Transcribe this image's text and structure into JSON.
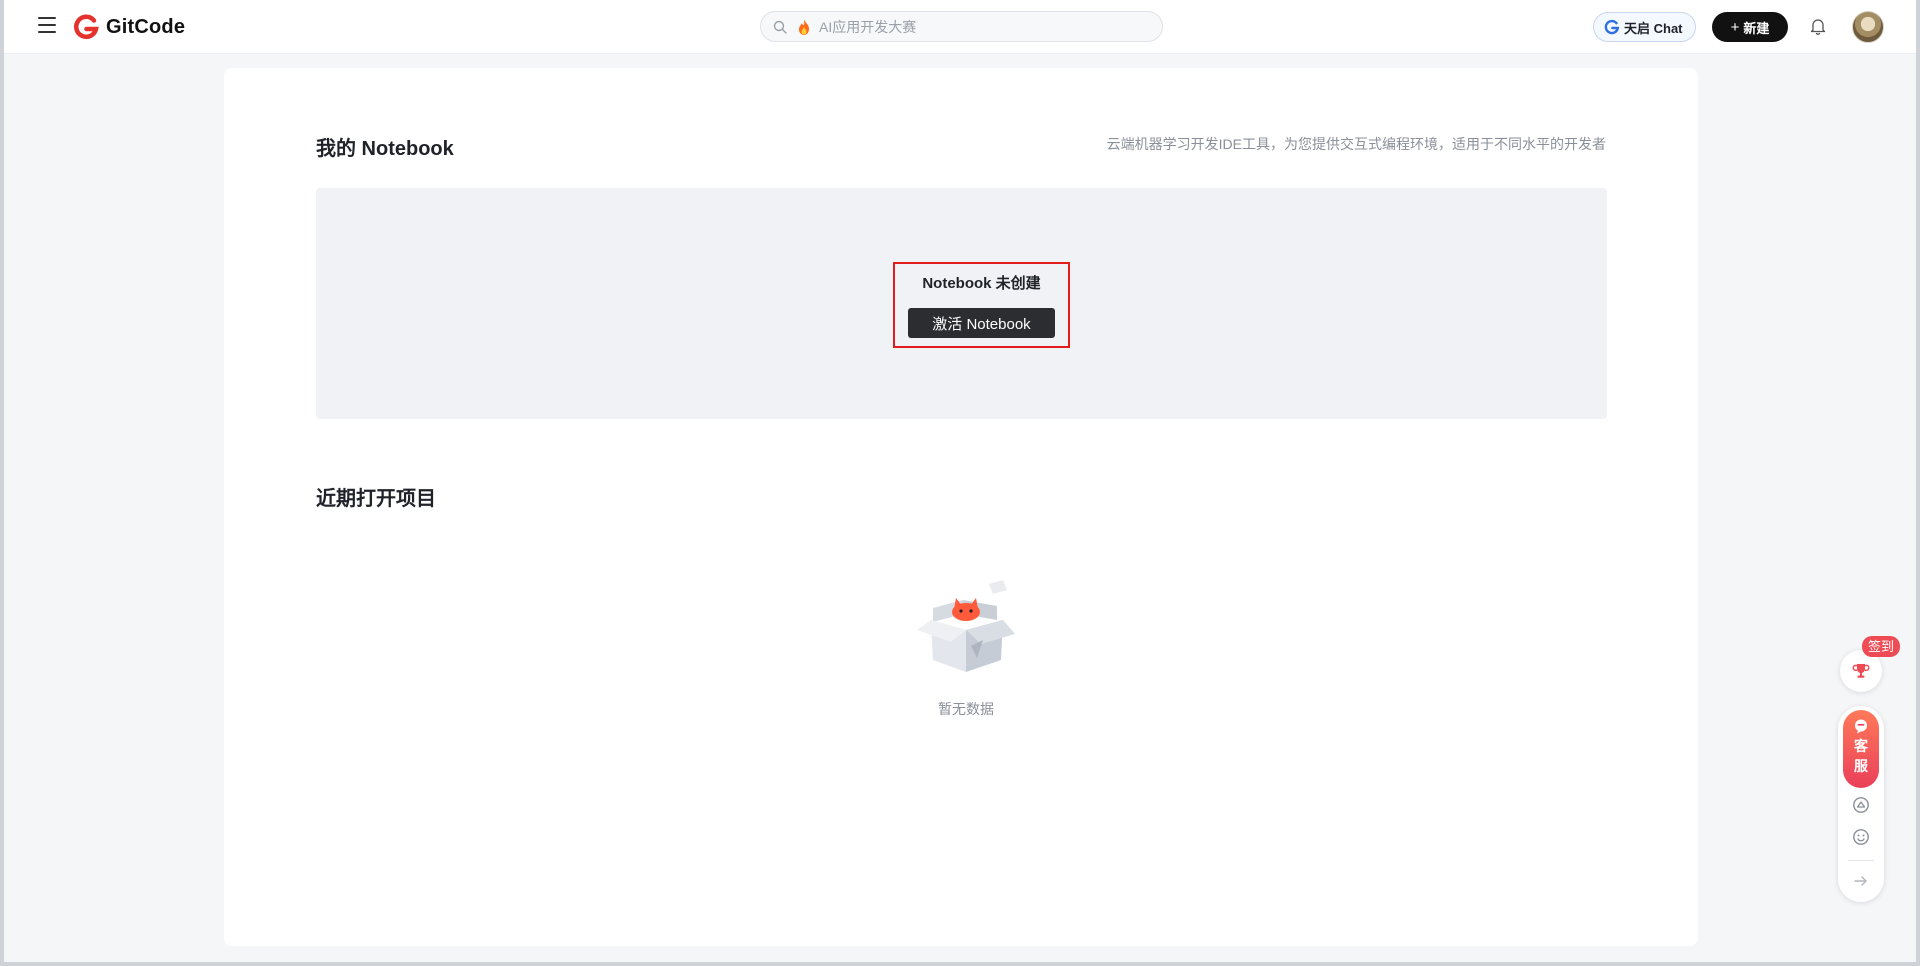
{
  "header": {
    "logo_text": "GitCode",
    "search_placeholder": "AI应用开发大赛",
    "chat_label": "天启 Chat",
    "new_label": "新建"
  },
  "notebook": {
    "title": "我的 Notebook",
    "subtitle": "云端机器学习开发IDE工具，为您提供交互式编程环境，适用于不同水平的开发者",
    "status": "Notebook 未创建",
    "activate_label": "激活 Notebook"
  },
  "recent": {
    "title": "近期打开项目",
    "empty_text": "暂无数据"
  },
  "side": {
    "checkin_label": "签到",
    "service_chars": [
      "客",
      "服"
    ]
  },
  "colors": {
    "brand": "#e5322d",
    "highlight": "#e21c1c",
    "service_gradient_top": "#ff7a59",
    "service_gradient_bottom": "#ea3f5a"
  },
  "icons": {
    "menu": "hamburger-menu-icon",
    "search": "search-icon",
    "fire": "fire-icon",
    "bell": "bell-icon",
    "trophy": "trophy-icon",
    "chat_bubble": "chat-bubble-icon",
    "feedback": "feedback-icon",
    "smile": "smile-icon",
    "arrow": "arrow-right-icon"
  }
}
